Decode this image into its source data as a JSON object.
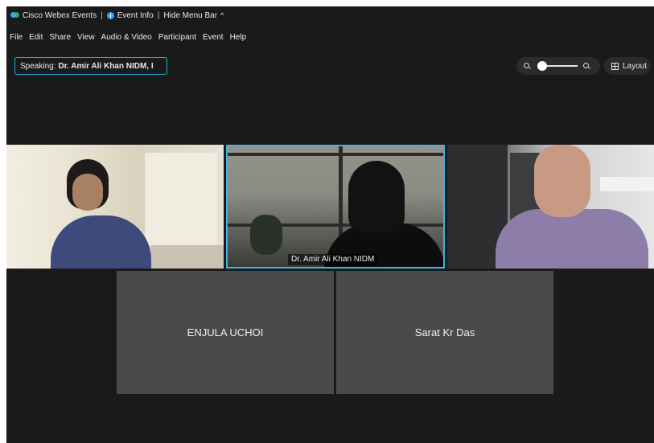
{
  "titlebar": {
    "app_name": "Cisco Webex Events",
    "event_info": "Event Info",
    "hide_menu": "Hide Menu Bar",
    "separator": "|"
  },
  "menu": {
    "items": [
      "File",
      "Edit",
      "Share",
      "View",
      "Audio & Video",
      "Participant",
      "Event",
      "Help"
    ]
  },
  "speaking": {
    "label": "Speaking:",
    "name": "Dr. Amir Ali Khan NIDM, I"
  },
  "toolbar": {
    "zoom_level": 0,
    "layout_label": "Layout"
  },
  "videos": {
    "active_speaker_name": "Dr. Amir Ali Khan NIDM"
  },
  "participants": [
    {
      "name": "ENJULA UCHOI"
    },
    {
      "name": "Sarat Kr Das"
    }
  ],
  "colors": {
    "background": "#1a1a1a",
    "active_border": "#3db3e6",
    "placeholder_tile": "#4a4a4a",
    "accent": "#3aa0ff"
  },
  "icons": [
    "webex-logo-icon",
    "info-icon",
    "chevron-up-icon",
    "zoom-out-icon",
    "zoom-in-icon",
    "grid-layout-icon"
  ]
}
